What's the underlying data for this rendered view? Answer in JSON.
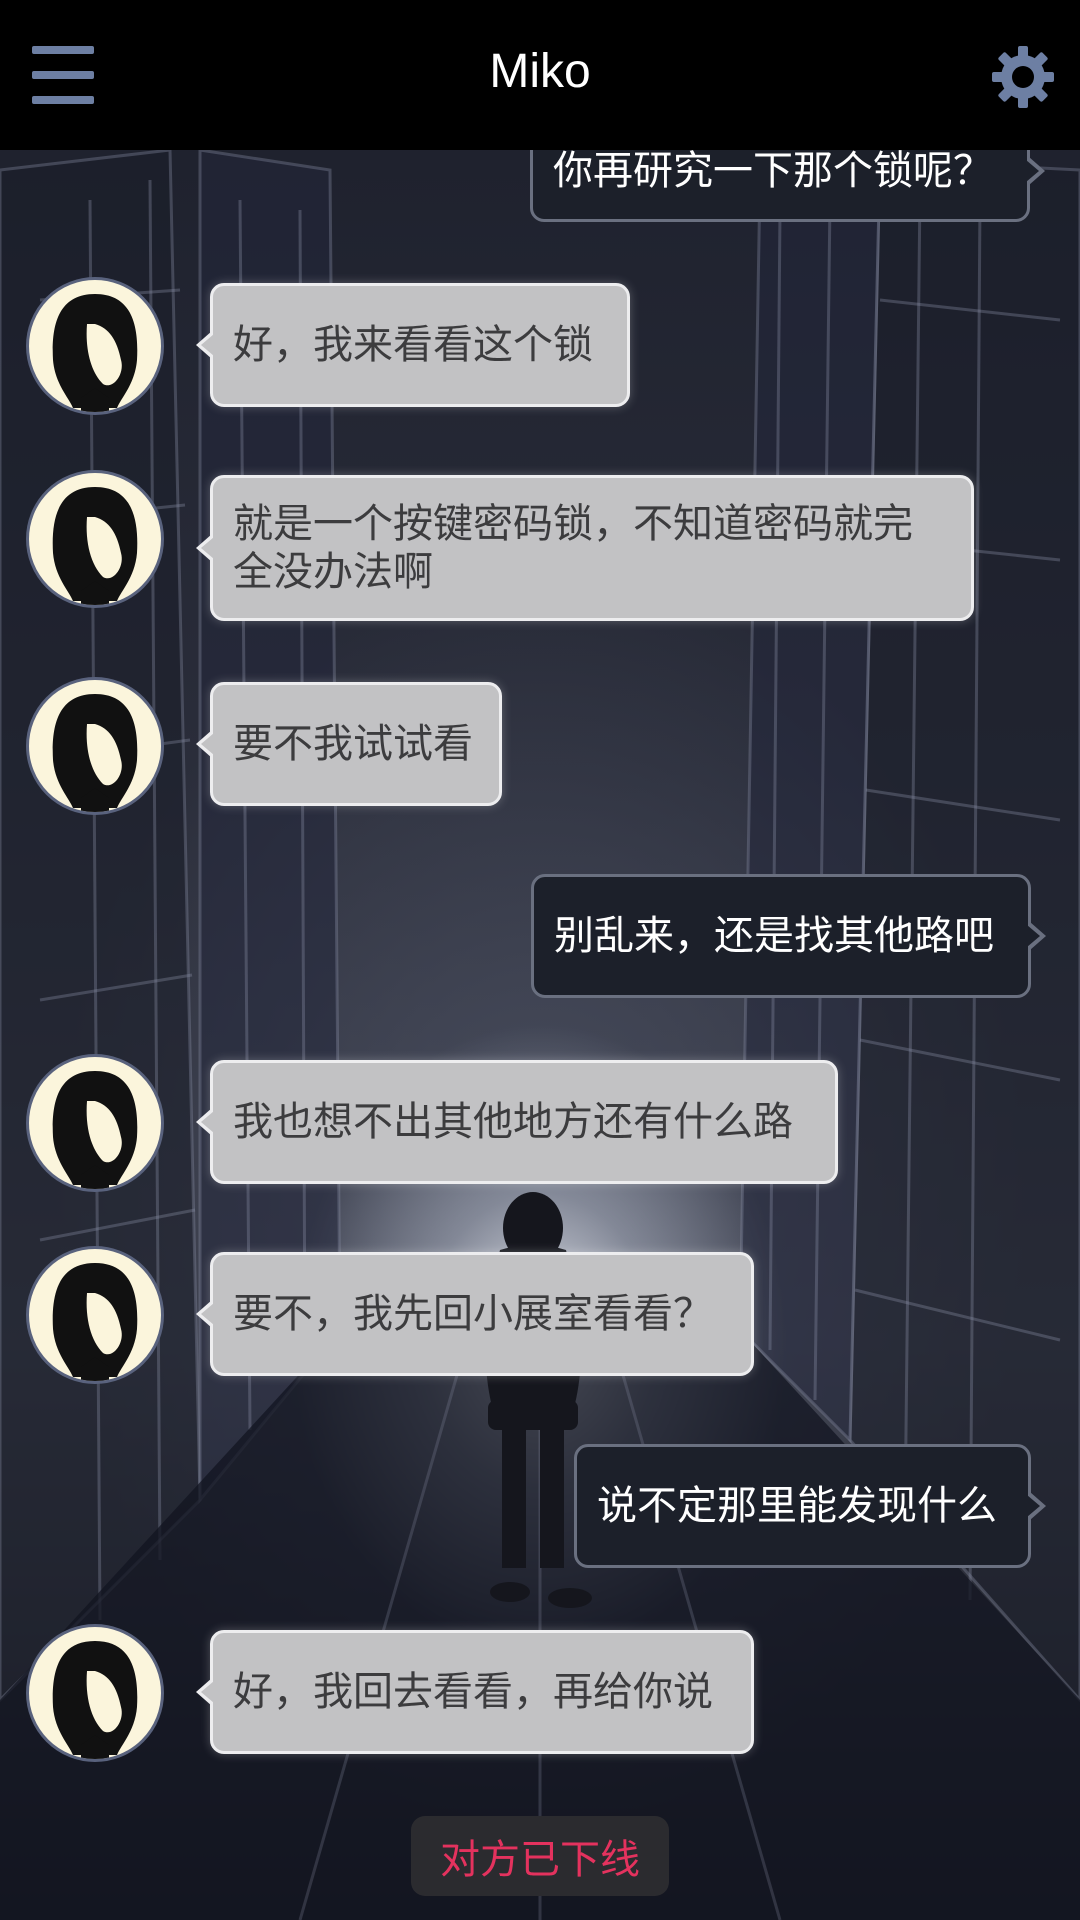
{
  "header": {
    "title": "Miko",
    "menu_icon": "hamburger-menu-icon",
    "settings_icon": "gear-icon"
  },
  "colors": {
    "header_bg": "#000000",
    "menu_icon": "#6d7fa3",
    "incoming_bubble": "#c2c2c4",
    "outgoing_bubble": "#1c202a",
    "status_text": "#e4325e"
  },
  "messages": [
    {
      "side": "right",
      "text": "你再研究一下那个锁呢？"
    },
    {
      "side": "left",
      "text": "好，我来看看这个锁"
    },
    {
      "side": "left",
      "text": "就是一个按键密码锁，不知道密码就完全没办法啊"
    },
    {
      "side": "left",
      "text": "要不我试试看"
    },
    {
      "side": "right",
      "text": "别乱来，还是找其他路吧"
    },
    {
      "side": "left",
      "text": "我也想不出其他地方还有什么路"
    },
    {
      "side": "left",
      "text": "要不，我先回小展室看看？"
    },
    {
      "side": "right",
      "text": "说不定那里能发现什么"
    },
    {
      "side": "left",
      "text": "好，我回去看看，再给你说"
    }
  ],
  "status": {
    "text": "对方已下线"
  }
}
